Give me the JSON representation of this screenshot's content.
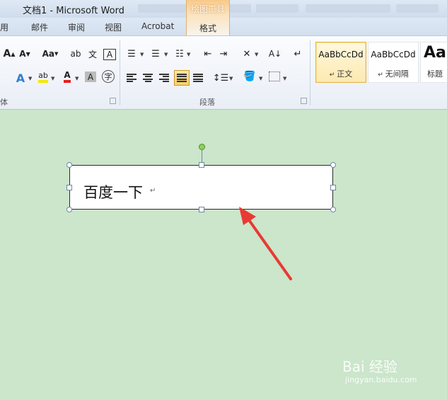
{
  "window": {
    "title": "文档1 - Microsoft Word"
  },
  "context_tab": {
    "title": "绘图工具",
    "tab": "格式"
  },
  "tabs": [
    "用",
    "邮件",
    "审阅",
    "视图",
    "Acrobat"
  ],
  "ribbon": {
    "font_group_label": "体",
    "paragraph_group_label": "段落",
    "font_buttons": {
      "grow": "A",
      "shrink": "A",
      "change_case": "Aa",
      "phonetic": "文",
      "char_border": "A",
      "font_color": "A",
      "char_shading": "A",
      "enclose": "字"
    }
  },
  "styles": [
    {
      "sample": "AaBbCcDd",
      "name": "正文",
      "selected": true
    },
    {
      "sample": "AaBbCcDd",
      "name": "无间隔",
      "selected": false
    },
    {
      "sample": "AaI",
      "name": "标题",
      "selected": false
    }
  ],
  "textbox": {
    "text": "百度一下",
    "mark": "↵"
  },
  "watermark": {
    "brand": "Bai 经验",
    "url": "jingyan.baidu.com"
  },
  "colors": {
    "accent_arrow": "#e83a33",
    "document_bg": "#cbe6cb",
    "context_tab": "#f7c98a"
  }
}
